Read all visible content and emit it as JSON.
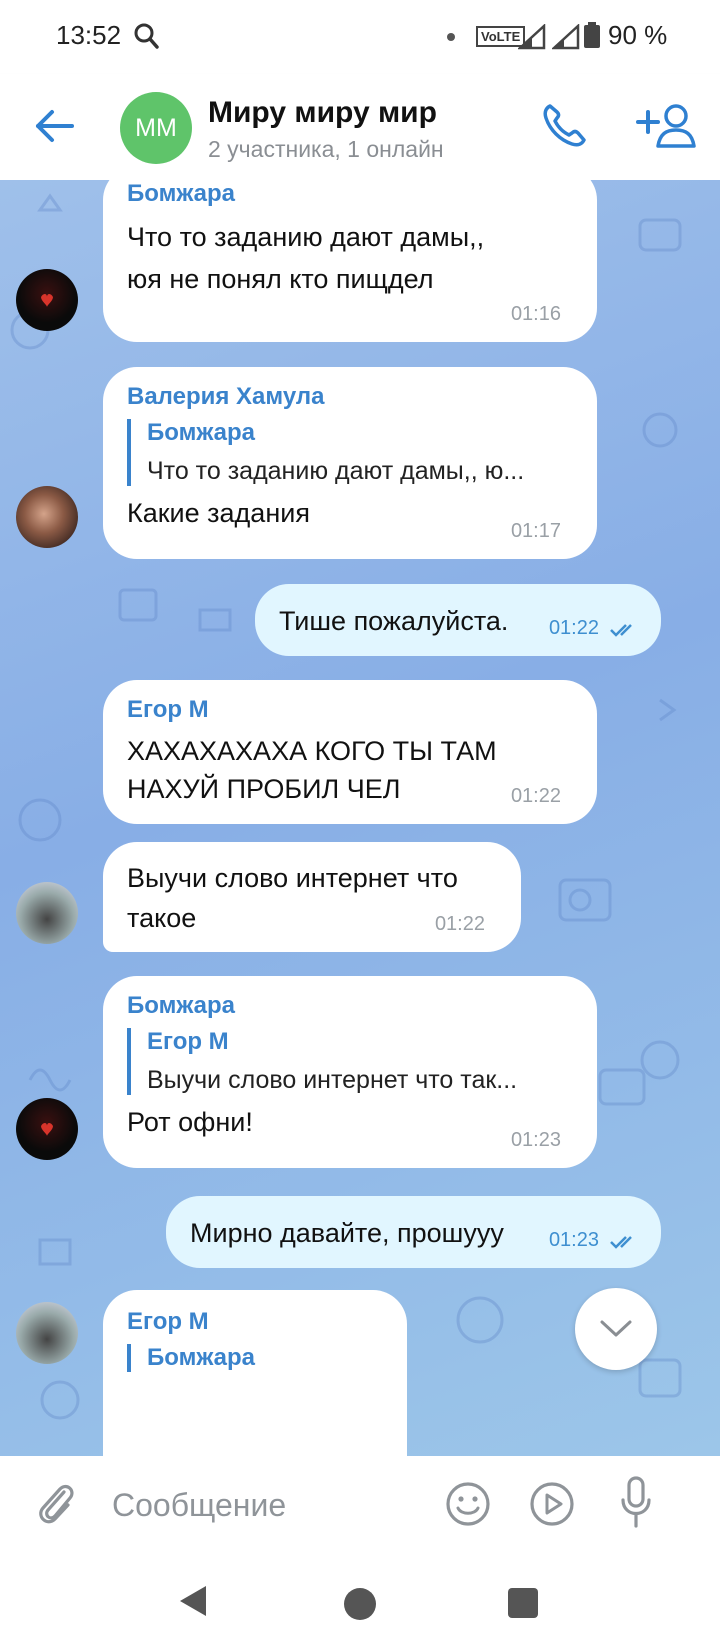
{
  "status_bar": {
    "time": "13:52",
    "volte": "VoLTE",
    "battery": "90 %"
  },
  "header": {
    "avatar_initials": "ММ",
    "title": "Миру миру мир",
    "subtitle": "2 участника, 1 онлайн"
  },
  "messages": [
    {
      "sender": "Бомжара",
      "text": "Что то заданию дают дамы,,\nюя не понял кто пищдел",
      "time": "01:16"
    },
    {
      "sender": "Валерия Хамула",
      "reply_name": "Бомжара",
      "reply_text": "Что то заданию дают дамы,, ю...",
      "text": "Какие задания",
      "time": "01:17"
    },
    {
      "text": "Тише пожалуйста.",
      "time": "01:22",
      "outgoing": true
    },
    {
      "sender": "Егор М",
      "text": "ХАХАХАХАХА КОГО ТЫ ТАМ\nНАХУЙ ПРОБИЛ ЧЕЛ",
      "time": "01:22"
    },
    {
      "text": "Выучи слово интернет что\nтакое",
      "time": "01:22"
    },
    {
      "sender": "Бомжара",
      "reply_name": "Егор М",
      "reply_text": "Выучи слово интернет что так...",
      "text": "Рот офни!",
      "time": "01:23"
    },
    {
      "text": "Мирно давайте, прошууу",
      "time": "01:23",
      "outgoing": true
    },
    {
      "sender": "Егор М",
      "reply_name": "Бомжара"
    }
  ],
  "input": {
    "placeholder": "Сообщение"
  },
  "colors": {
    "accent": "#3a83cc",
    "outgoing_bubble": "#e1f6ff",
    "avatar_green": "#5fc46a"
  }
}
